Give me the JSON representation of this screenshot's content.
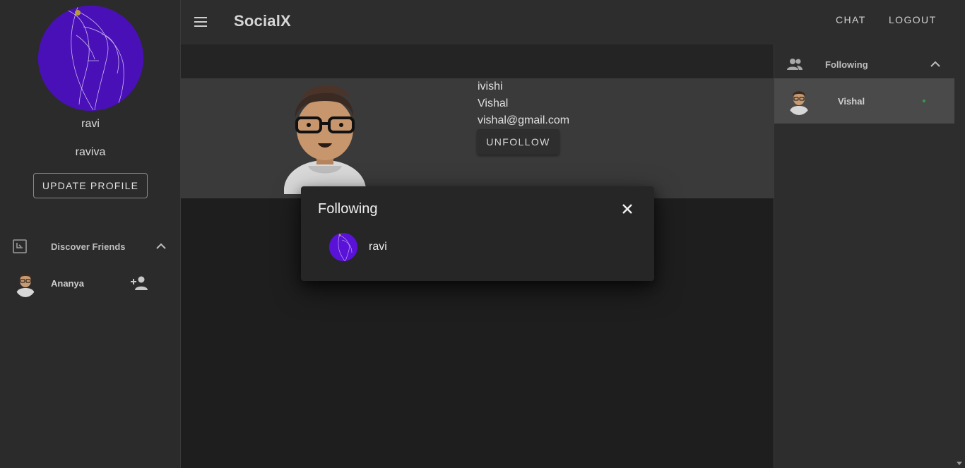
{
  "app": {
    "brand": "SocialX"
  },
  "topbar": {
    "chat_label": "CHAT",
    "logout_label": "LOGOUT"
  },
  "sidebar": {
    "user": {
      "name": "ravi",
      "handle": "raviva"
    },
    "update_profile_label": "UPDATE PROFILE",
    "discover": {
      "title": "Discover Friends",
      "items": [
        {
          "name": "Ananya"
        }
      ]
    }
  },
  "profile": {
    "username": "ivishi",
    "name": "Vishal",
    "email": "vishal@gmail.com",
    "unfollow_label": "UNFOLLOW"
  },
  "right_panel": {
    "title": "Following",
    "items": [
      {
        "name": "Vishal",
        "online": true
      }
    ]
  },
  "dialog": {
    "title": "Following",
    "items": [
      {
        "name": "ravi"
      }
    ]
  },
  "colors": {
    "accent_purple": "#4a10b8",
    "online": "#2e9e4a"
  }
}
